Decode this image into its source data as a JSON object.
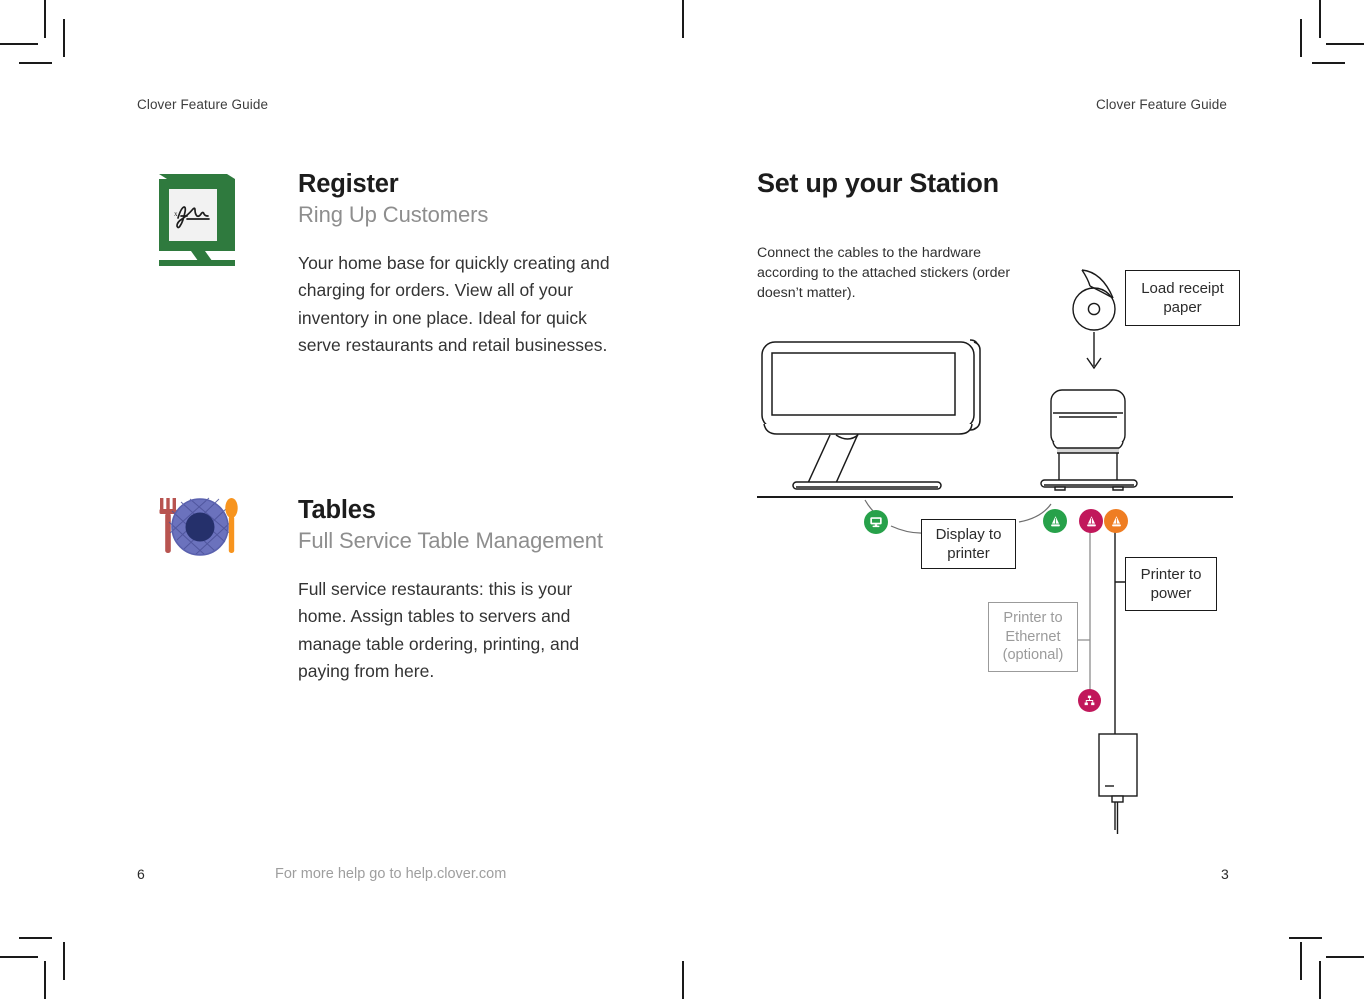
{
  "document": {
    "running_head_left": "Clover Feature Guide",
    "running_head_right": "Clover Feature Guide",
    "footer_help": "For more help go to help.clover.com",
    "folio_left": "6",
    "folio_right": "3"
  },
  "left_page": {
    "features": [
      {
        "icon": "register-terminal-icon",
        "title": "Register",
        "subtitle": "Ring Up Customers",
        "body": "Your home base for quickly creating and charging for orders. View all of your inventory in one place. Ideal for quick serve restaurants and retail businesses."
      },
      {
        "icon": "tables-plate-fork-spoon-icon",
        "title": "Tables",
        "subtitle": "Full Service Table Management",
        "body": "Full service restaurants: this is your home. Assign tables to servers and manage table ordering, printing, and paying from here."
      }
    ]
  },
  "right_page": {
    "title": "Set up your Station",
    "intro": "Connect the cables to the hardware according to the attached stickers (order doesn’t matter).",
    "callouts": [
      {
        "id": "load-receipt-paper",
        "text": "Load receipt paper",
        "muted": false
      },
      {
        "id": "display-to-printer",
        "text": "Display to printer",
        "muted": false
      },
      {
        "id": "printer-to-power",
        "text": "Printer to power",
        "muted": false
      },
      {
        "id": "printer-to-ethernet",
        "text": "Printer to Ethernet (optional)",
        "muted": true
      }
    ],
    "connectors": [
      {
        "id": "display-connector",
        "icon": "display-monitor-icon",
        "color": "#27a14a"
      },
      {
        "id": "printer-green-connector",
        "icon": "printer-cone-icon",
        "color": "#27a14a"
      },
      {
        "id": "printer-magenta-connector",
        "icon": "printer-cone-icon",
        "color": "#c1185b"
      },
      {
        "id": "printer-orange-connector",
        "icon": "printer-cone-icon",
        "color": "#ef7d22"
      },
      {
        "id": "ethernet-connector",
        "icon": "ethernet-network-icon",
        "color": "#c1185b"
      }
    ],
    "artwork": [
      "clover-station-display-illustration",
      "receipt-printer-illustration",
      "receipt-paper-roll-illustration",
      "power-brick-illustration"
    ]
  },
  "colors": {
    "register_green": "#2f7a3e",
    "fork_red": "#b85450",
    "plate_blue": "#6b72bd",
    "plate_center_navy": "#25306b",
    "spoon_orange": "#f7941e",
    "connector_green": "#27a14a",
    "connector_magenta": "#c1185b",
    "connector_orange": "#ef7d22",
    "muted_gray": "#9b9b9b"
  }
}
